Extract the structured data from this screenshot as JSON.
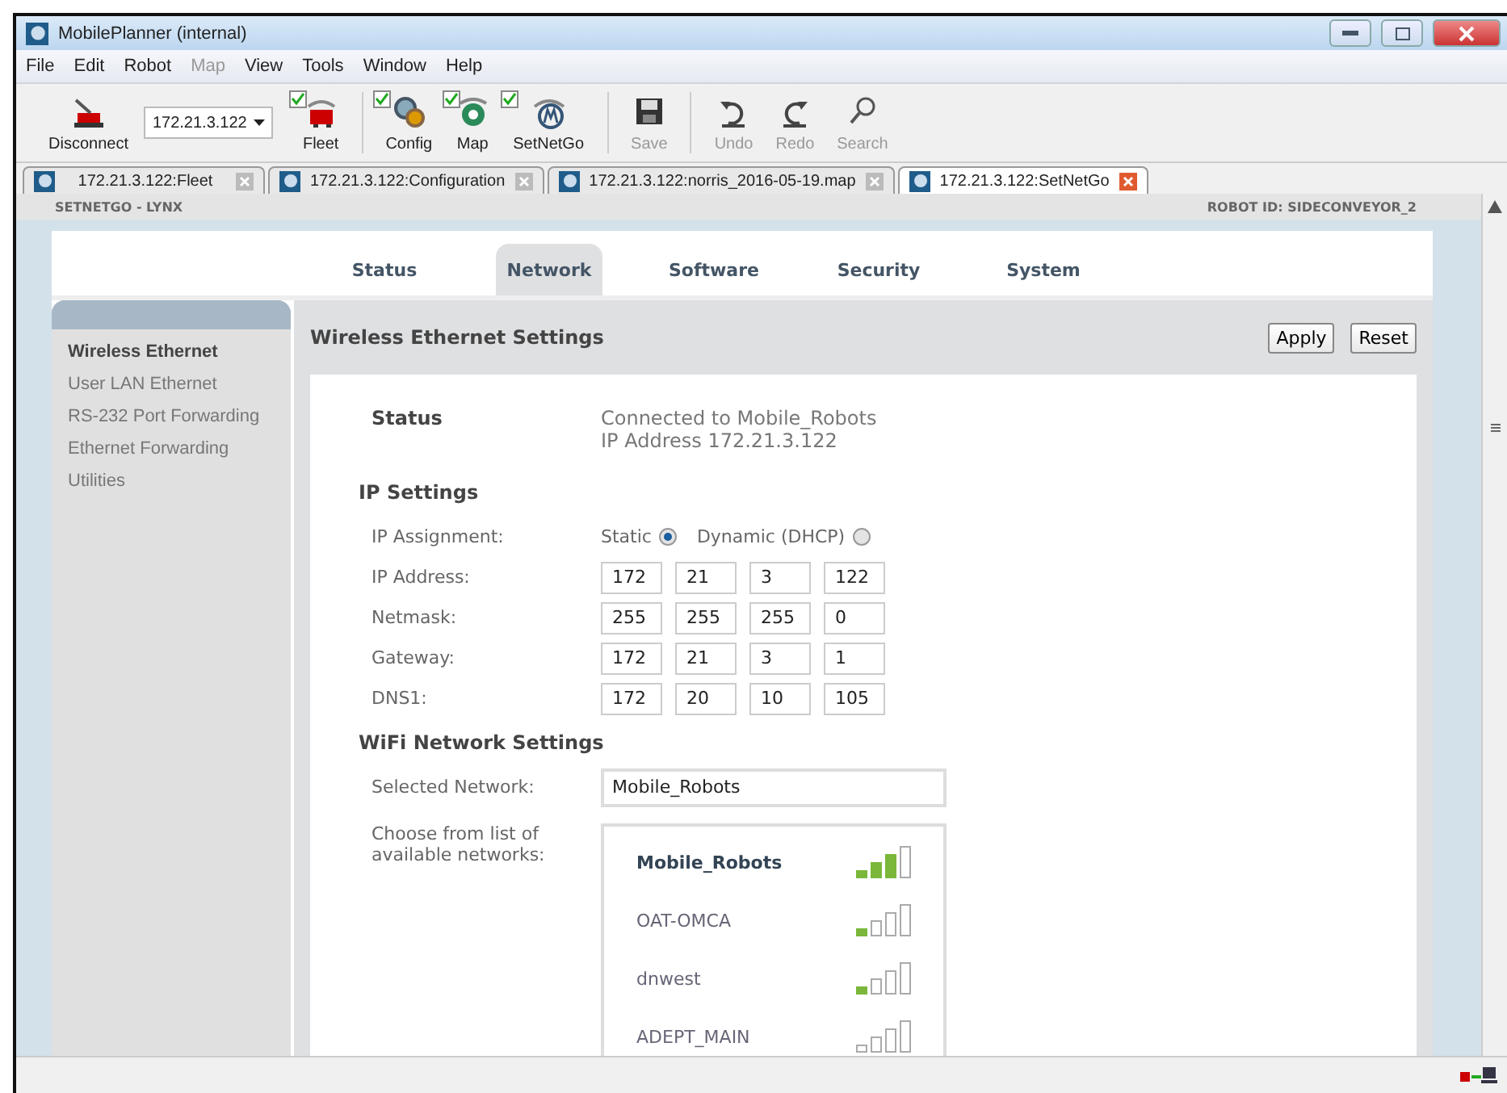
{
  "window": {
    "title": "MobilePlanner (internal)"
  },
  "menu": [
    {
      "label": "File",
      "disabled": false
    },
    {
      "label": "Edit",
      "disabled": false
    },
    {
      "label": "Robot",
      "disabled": false
    },
    {
      "label": "Map",
      "disabled": true
    },
    {
      "label": "View",
      "disabled": false
    },
    {
      "label": "Tools",
      "disabled": false
    },
    {
      "label": "Window",
      "disabled": false
    },
    {
      "label": "Help",
      "disabled": false
    }
  ],
  "toolbar": [
    {
      "kind": "button",
      "label": "Disconnect",
      "disabled": false
    },
    {
      "kind": "combo",
      "value": "172.21.3.122"
    },
    {
      "kind": "toggle",
      "label": "Fleet",
      "checked": true,
      "disabled": false
    },
    {
      "kind": "separator"
    },
    {
      "kind": "toggle",
      "label": "Config",
      "checked": true,
      "disabled": false
    },
    {
      "kind": "toggle",
      "label": "Map",
      "checked": true,
      "disabled": false
    },
    {
      "kind": "toggle",
      "label": "SetNetGo",
      "checked": true,
      "disabled": false
    },
    {
      "kind": "separator"
    },
    {
      "kind": "button",
      "label": "Save",
      "disabled": true
    },
    {
      "kind": "separator"
    },
    {
      "kind": "button",
      "label": "Undo",
      "disabled": true
    },
    {
      "kind": "button",
      "label": "Redo",
      "disabled": true
    },
    {
      "kind": "button",
      "label": "Search",
      "disabled": true
    }
  ],
  "doc_tabs": [
    {
      "label": "172.21.3.122:Fleet",
      "selected": false
    },
    {
      "label": "172.21.3.122:Configuration",
      "selected": false
    },
    {
      "label": "172.21.3.122:norris_2016-05-19.map",
      "selected": false
    },
    {
      "label": "172.21.3.122:SetNetGo",
      "selected": true
    }
  ],
  "header": {
    "left": "SETNETGO - LYNX",
    "right": "ROBOT ID: SIDECONVEYOR_2"
  },
  "tabs": [
    {
      "label": "Status",
      "selected": false
    },
    {
      "label": "Network",
      "selected": true
    },
    {
      "label": "Software",
      "selected": false
    },
    {
      "label": "Security",
      "selected": false
    },
    {
      "label": "System",
      "selected": false
    }
  ],
  "sidebar": {
    "items": [
      {
        "label": "Wireless Ethernet",
        "selected": true
      },
      {
        "label": "User LAN Ethernet",
        "selected": false
      },
      {
        "label": "RS-232 Port Forwarding",
        "selected": false
      },
      {
        "label": "Ethernet Forwarding",
        "selected": false
      },
      {
        "label": "Utilities",
        "selected": false
      }
    ]
  },
  "panel": {
    "title": "Wireless Ethernet Settings",
    "buttons": [
      "Apply",
      "Reset"
    ],
    "status": {
      "label": "Status",
      "lines": [
        "Connected to Mobile_Robots",
        "IP Address 172.21.3.122"
      ]
    },
    "ip_settings": {
      "title": "IP Settings",
      "assignment_label": "IP Assignment:",
      "options": [
        {
          "label": "Static",
          "selected": true
        },
        {
          "label": "Dynamic (DHCP)",
          "selected": false
        }
      ],
      "rows": [
        {
          "label": "IP Address:",
          "octets": [
            "172",
            "21",
            "3",
            "122"
          ]
        },
        {
          "label": "Netmask:",
          "octets": [
            "255",
            "255",
            "255",
            "0"
          ]
        },
        {
          "label": "Gateway:",
          "octets": [
            "172",
            "21",
            "3",
            "1"
          ]
        },
        {
          "label": "DNS1:",
          "octets": [
            "172",
            "20",
            "10",
            "105"
          ]
        }
      ]
    },
    "wifi": {
      "title": "WiFi Network Settings",
      "selected_label": "Selected Network:",
      "selected_value": "Mobile_Robots",
      "list_label": "Choose from list of available networks:",
      "networks": [
        {
          "name": "Mobile_Robots",
          "selected": true
        },
        {
          "name": "OAT-OMCA",
          "selected": false
        },
        {
          "name": "dnwest",
          "selected": false
        },
        {
          "name": "ADEPT_MAIN",
          "selected": false
        }
      ]
    }
  }
}
